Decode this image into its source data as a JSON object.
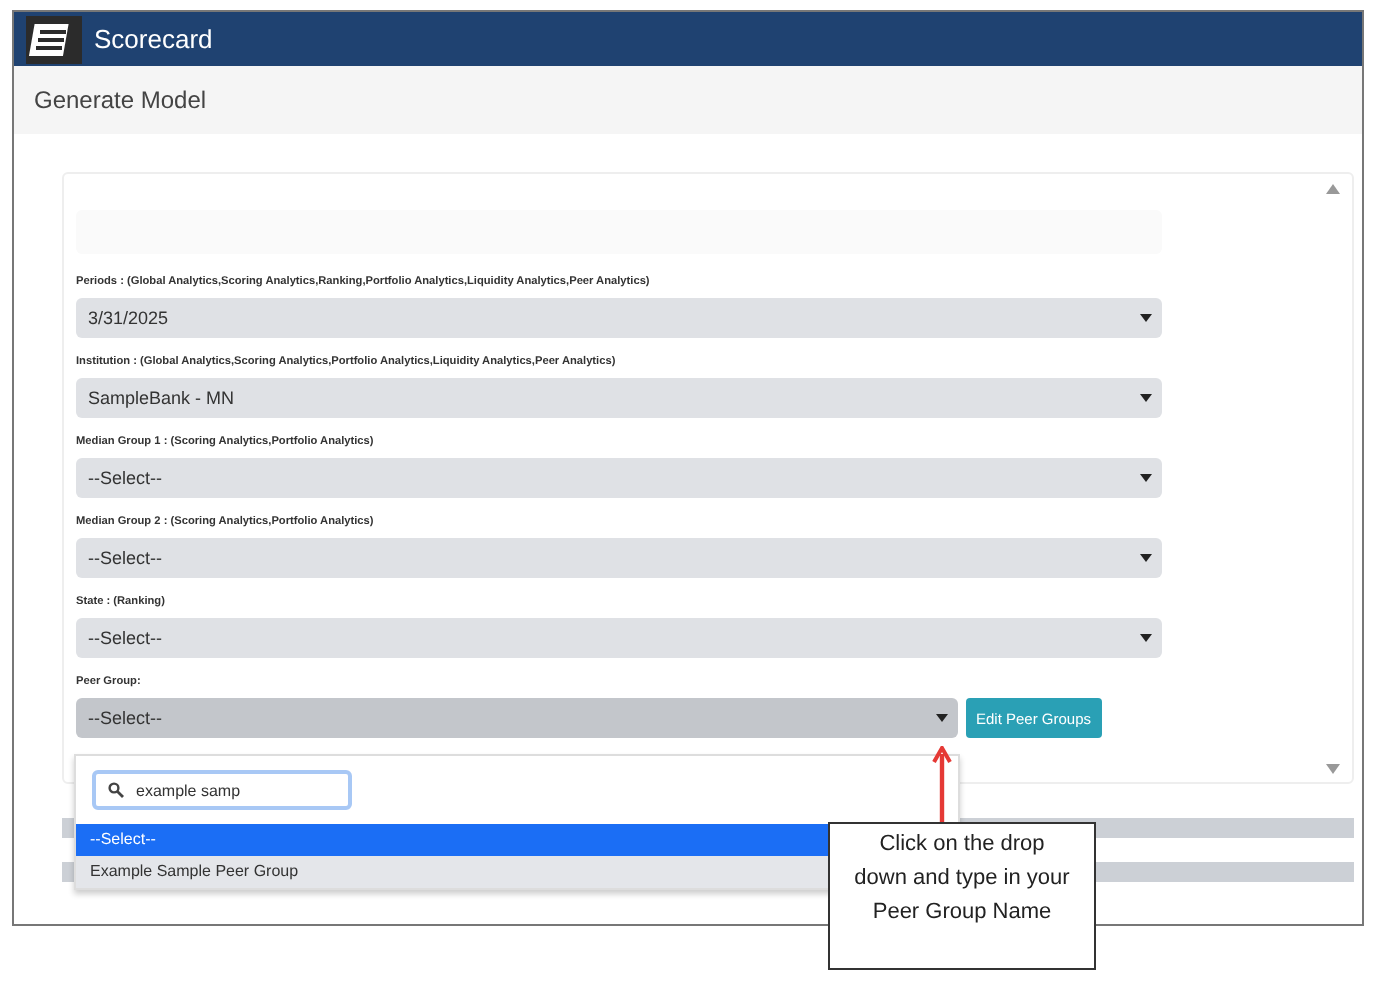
{
  "app": {
    "title": "Scorecard"
  },
  "page": {
    "title": "Generate Model"
  },
  "fields": [
    {
      "label": "Periods : (Global Analytics,Scoring Analytics,Ranking,Portfolio Analytics,Liquidity Analytics,Peer Analytics)",
      "value": "3/31/2025"
    },
    {
      "label": "Institution : (Global Analytics,Scoring Analytics,Portfolio Analytics,Liquidity Analytics,Peer Analytics)",
      "value": "SampleBank - MN"
    },
    {
      "label": "Median Group 1 : (Scoring Analytics,Portfolio Analytics)",
      "value": "--Select--"
    },
    {
      "label": "Median Group 2 : (Scoring Analytics,Portfolio Analytics)",
      "value": "--Select--"
    },
    {
      "label": "State : (Ranking)",
      "value": "--Select--"
    }
  ],
  "peer_group": {
    "label": "Peer Group:",
    "value": "--Select--",
    "button": "Edit Peer Groups",
    "dropdown": {
      "search": "example samp",
      "options": [
        {
          "label": "--Select--",
          "selected": true
        },
        {
          "label": "Example Sample Peer Group",
          "selected": false
        }
      ]
    }
  },
  "callout": {
    "text": "Click on the drop down and type in your Peer Group Name"
  }
}
